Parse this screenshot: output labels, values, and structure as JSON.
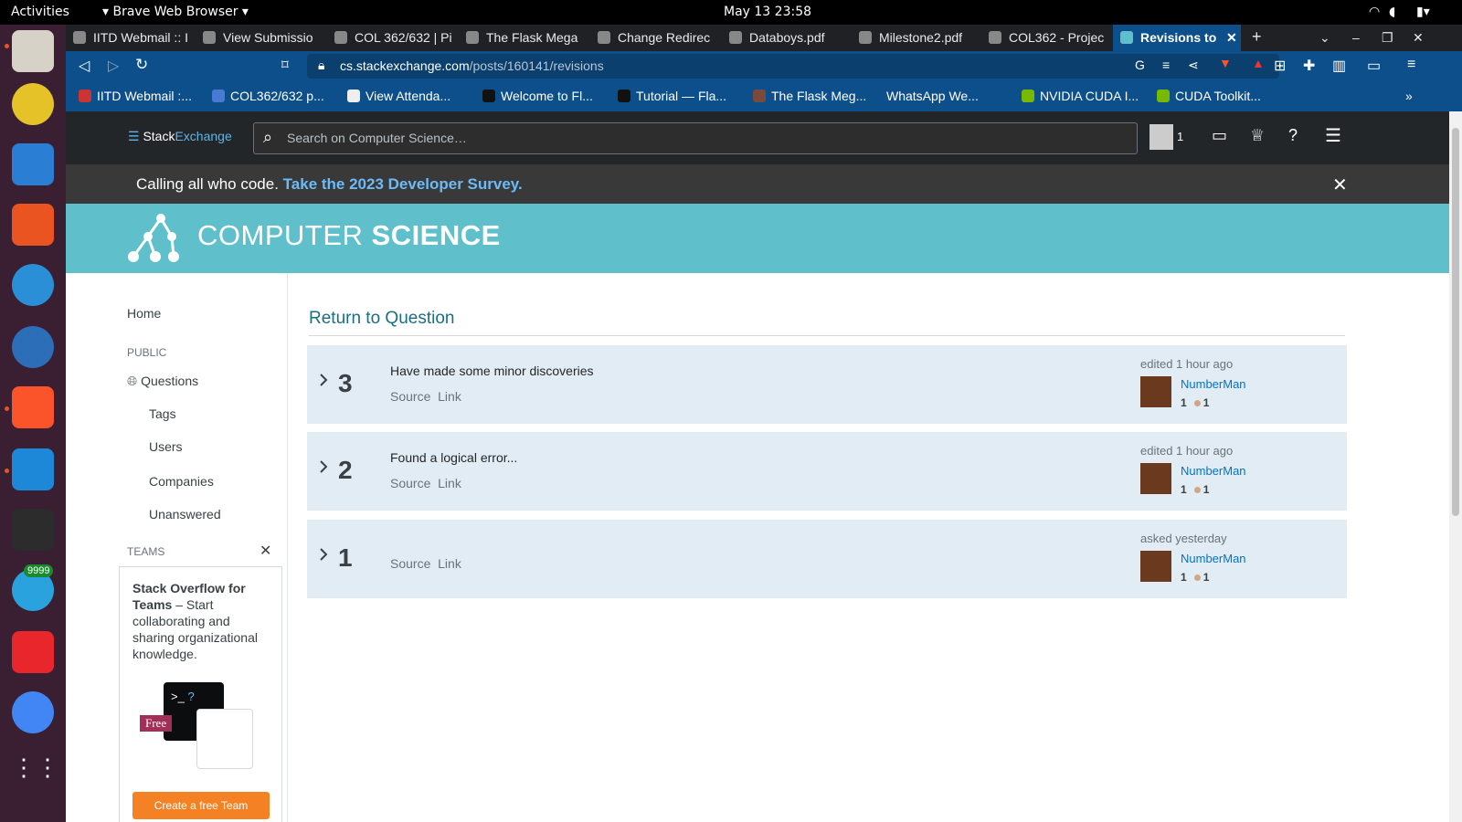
{
  "system": {
    "activities": "Activities",
    "app": "Brave Web Browser",
    "clock": "May 13  23:58"
  },
  "dock": {
    "telegram_badge": "9999"
  },
  "tabs": [
    {
      "title": "IITD Webmail :: I",
      "active": false
    },
    {
      "title": "View Submissio",
      "active": false
    },
    {
      "title": "COL 362/632 | Pi",
      "active": false
    },
    {
      "title": "The Flask Mega",
      "active": false
    },
    {
      "title": "Change Redirec",
      "active": false
    },
    {
      "title": "Databoys.pdf",
      "active": false
    },
    {
      "title": "Milestone2.pdf",
      "active": false
    },
    {
      "title": "COL362 - Projec",
      "active": false
    },
    {
      "title": "Revisions to",
      "active": true
    }
  ],
  "address": {
    "host": "cs.stackexchange.com",
    "path": "/posts/160141/revisions"
  },
  "bookmarks": [
    "IITD Webmail :...",
    "COL362/632 p...",
    "View Attenda...",
    "Welcome to Fl...",
    "Tutorial — Fla...",
    "The Flask Meg...",
    "WhatsApp We...",
    "NVIDIA CUDA I...",
    "CUDA Toolkit..."
  ],
  "se": {
    "logo_a": "Stack",
    "logo_b": "Exchange",
    "search_placeholder": "Search on Computer Science…",
    "rep": "1"
  },
  "banner": {
    "text": "Calling all who code.",
    "link": "Take the 2023 Developer Survey."
  },
  "site": {
    "title_a": "COMPUTER ",
    "title_b": "SCIENCE",
    "accent": "#5fc0cb"
  },
  "sidebar": {
    "home": "Home",
    "public": "PUBLIC",
    "questions": "Questions",
    "tags": "Tags",
    "users": "Users",
    "companies": "Companies",
    "unanswered": "Unanswered",
    "teams": "TEAMS",
    "teams_promo_bold": "Stack Overflow for Teams",
    "teams_promo_rest": " – Start collaborating and sharing organizational knowledge.",
    "free": "Free",
    "cta": "Create a free Team"
  },
  "main": {
    "return_link": "Return to Question",
    "source": "Source",
    "link": "Link",
    "revisions": [
      {
        "num": "3",
        "comment": "Have made some minor discoveries",
        "when": "edited 1 hour ago",
        "user": "NumberMan",
        "rep": "1",
        "bronze": "1"
      },
      {
        "num": "2",
        "comment": "Found a logical error...",
        "when": "edited 1 hour ago",
        "user": "NumberMan",
        "rep": "1",
        "bronze": "1"
      },
      {
        "num": "1",
        "comment": "",
        "when": "asked yesterday",
        "user": "NumberMan",
        "rep": "1",
        "bronze": "1"
      }
    ]
  }
}
